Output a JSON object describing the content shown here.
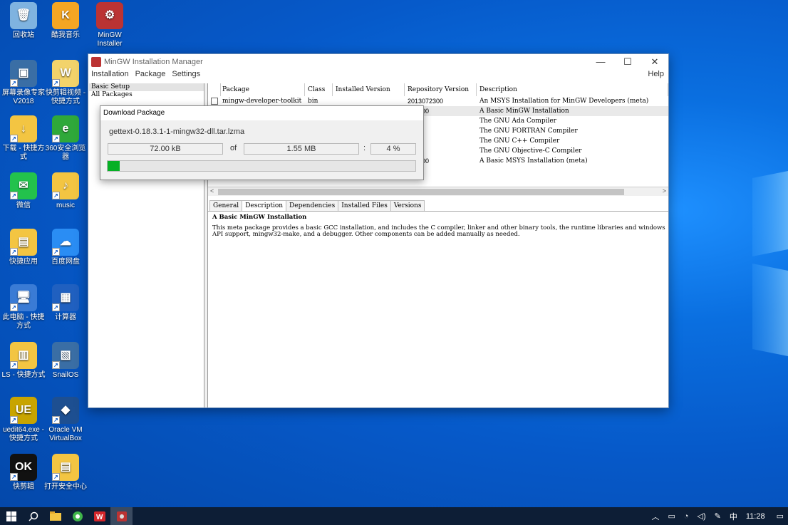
{
  "desktop": {
    "icons": [
      {
        "label": "回收站",
        "glyph": "🗑"
      },
      {
        "label": "酷我音乐",
        "glyph": "K"
      },
      {
        "label": "MinGW Installer",
        "glyph": "⚙"
      },
      {
        "label": "屏幕录像专家 V2018",
        "glyph": "▣"
      },
      {
        "label": "快剪辑视频 - 快捷方式",
        "glyph": "W"
      },
      {
        "label": "下载 - 快捷方式",
        "glyph": "↓"
      },
      {
        "label": "360安全浏览器",
        "glyph": "e"
      },
      {
        "label": "微信",
        "glyph": "✉"
      },
      {
        "label": "music",
        "glyph": "♪"
      },
      {
        "label": "快捷应用",
        "glyph": "▤"
      },
      {
        "label": "百度网盘",
        "glyph": "☁"
      },
      {
        "label": "此电脑 - 快捷方式",
        "glyph": "🖥"
      },
      {
        "label": "计算器",
        "glyph": "▦"
      },
      {
        "label": "LS - 快捷方式",
        "glyph": "▥"
      },
      {
        "label": "SnailOS",
        "glyph": "▧"
      },
      {
        "label": "uedit64.exe - 快捷方式",
        "glyph": "UE"
      },
      {
        "label": "Oracle VM VirtualBox",
        "glyph": "◆"
      },
      {
        "label": "快剪辑",
        "glyph": "OK"
      },
      {
        "label": "打开安全中心",
        "glyph": "▤"
      }
    ]
  },
  "window": {
    "title": "MinGW Installation Manager",
    "minimize": "—",
    "maximize": "☐",
    "close": "✕",
    "menu": [
      "Installation",
      "Package",
      "Settings"
    ],
    "help": "Help"
  },
  "sidebar": {
    "items": [
      "Basic Setup",
      "All Packages"
    ]
  },
  "packages": {
    "columns": [
      "Package",
      "Class",
      "Installed Version",
      "Repository Version",
      "Description"
    ],
    "rows": [
      {
        "package": "mingw-developer-toolkit",
        "class": "bin",
        "installed": "",
        "repo": "2013072300",
        "desc": "An MSYS Installation for MinGW Developers (meta)"
      },
      {
        "package": "",
        "class": "",
        "installed": "",
        "repo": "072200",
        "desc": "A Basic MinGW Installation"
      },
      {
        "package": "",
        "class": "",
        "installed": "",
        "repo": "0-1",
        "desc": "The GNU Ada Compiler"
      },
      {
        "package": "",
        "class": "",
        "installed": "",
        "repo": "0-1",
        "desc": "The GNU FORTRAN Compiler"
      },
      {
        "package": "",
        "class": "",
        "installed": "",
        "repo": "0-1",
        "desc": "The GNU C++ Compiler"
      },
      {
        "package": "",
        "class": "",
        "installed": "",
        "repo": "0-1",
        "desc": "The GNU Objective-C Compiler"
      },
      {
        "package": "",
        "class": "",
        "installed": "",
        "repo": "072300",
        "desc": "A Basic MSYS Installation (meta)"
      }
    ]
  },
  "details": {
    "tabs": [
      "General",
      "Description",
      "Dependencies",
      "Installed Files",
      "Versions"
    ],
    "active_tab": "Description",
    "title": "A Basic MinGW Installation",
    "text": "This meta package provides a basic GCC installation, and includes the C compiler, linker and other binary tools, the runtime libraries and windows API support, mingw32-make, and a debugger. Other components can be added manually as needed."
  },
  "download": {
    "title": "Download Package",
    "filename": "gettext-0.18.3.1-1-mingw32-dll.tar.lzma",
    "downloaded": "72.00 kB",
    "of_label": "of",
    "total": "1.55 MB",
    "colon": ":",
    "percent_label": "4 %",
    "progress": 0.04
  },
  "taskbar": {
    "clock": "11:28",
    "ime": "中",
    "colors": {
      "bg": "#0d1e36",
      "progress": "#06b025"
    }
  }
}
